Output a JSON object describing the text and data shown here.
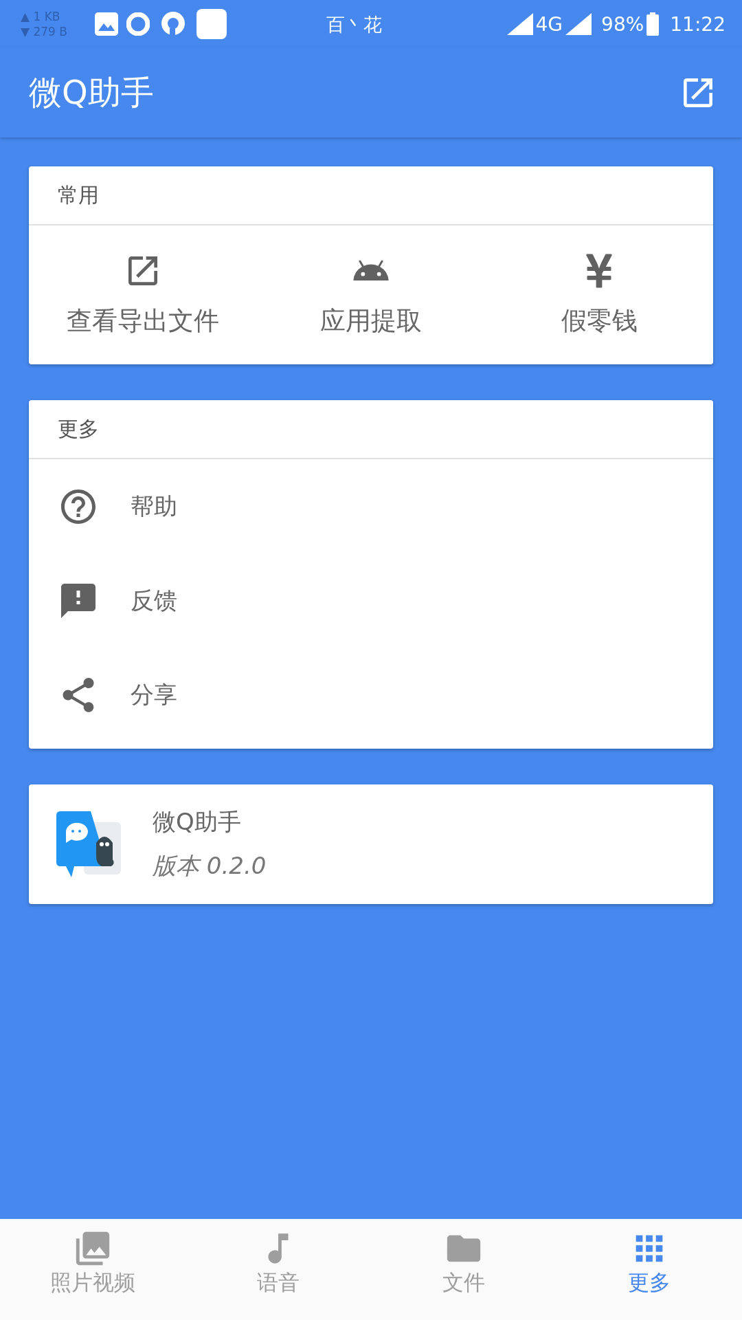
{
  "status_bar": {
    "upload": "▲ 1 KB",
    "download": "▼ 279 B",
    "carrier": "百丶花",
    "network": "4G",
    "battery": "98%",
    "time": "11:22"
  },
  "app_bar": {
    "title": "微Q助手"
  },
  "common_card": {
    "title": "常用",
    "items": [
      {
        "label": "查看导出文件"
      },
      {
        "label": "应用提取"
      },
      {
        "label": "假零钱"
      }
    ]
  },
  "more_card": {
    "title": "更多",
    "items": [
      {
        "label": "帮助"
      },
      {
        "label": "反馈"
      },
      {
        "label": "分享"
      }
    ]
  },
  "about_card": {
    "name": "微Q助手",
    "version": "版本 0.2.0"
  },
  "bottom_nav": [
    {
      "label": "照片视频",
      "selected": false
    },
    {
      "label": "语音",
      "selected": false
    },
    {
      "label": "文件",
      "selected": false
    },
    {
      "label": "更多",
      "selected": true
    }
  ]
}
